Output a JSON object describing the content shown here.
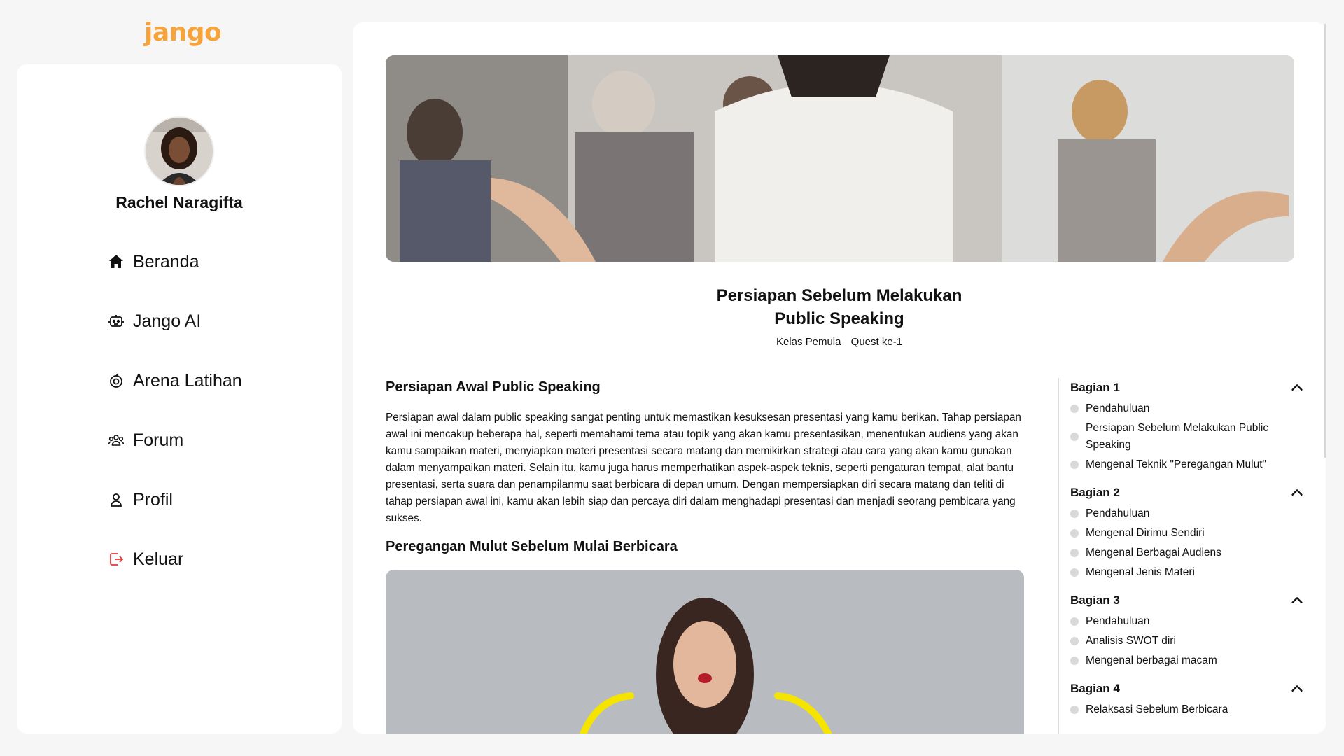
{
  "app": {
    "logo": "jango",
    "brand_color": "#f5a33a"
  },
  "sidebar": {
    "user_name": "Rachel Naragifta",
    "items": [
      {
        "label": "Beranda",
        "icon": "home-icon"
      },
      {
        "label": "Jango AI",
        "icon": "robot-icon"
      },
      {
        "label": "Arena Latihan",
        "icon": "target-icon"
      },
      {
        "label": "Forum",
        "icon": "users-icon"
      },
      {
        "label": "Profil",
        "icon": "user-icon"
      },
      {
        "label": "Keluar",
        "icon": "logout-icon",
        "color": "#e53935"
      }
    ]
  },
  "lesson": {
    "title_line1": "Persiapan Sebelum Melakukan",
    "title_line2": "Public Speaking",
    "class_label": "Kelas Pemula",
    "quest_label": "Quest ke-1",
    "section1_heading": "Persiapan Awal Public Speaking",
    "section1_body": "Persiapan awal dalam public speaking sangat penting untuk memastikan kesuksesan presentasi yang kamu berikan. Tahap persiapan awal ini mencakup beberapa hal, seperti memahami tema atau topik yang akan kamu presentasikan, menentukan audiens yang akan kamu sampaikan materi, menyiapkan materi presentasi secara matang dan memikirkan strategi atau cara yang akan kamu gunakan dalam menyampaikan materi. Selain itu, kamu juga harus memperhatikan aspek-aspek teknis, seperti pengaturan tempat, alat bantu presentasi, serta suara dan penampilanmu saat berbicara di depan umum. Dengan mempersiapkan diri secara matang dan teliti di tahap persiapan awal ini, kamu akan lebih siap dan percaya diri dalam menghadapi presentasi dan menjadi seorang pembicara yang sukses.",
    "section2_heading": "Peregangan Mulut Sebelum Mulai Berbicara"
  },
  "outline": {
    "sections": [
      {
        "title": "Bagian 1",
        "items": [
          "Pendahuluan",
          "Persiapan Sebelum Melakukan Public Speaking",
          "Mengenal Teknik \"Peregangan Mulut\""
        ]
      },
      {
        "title": "Bagian 2",
        "items": [
          "Pendahuluan",
          "Mengenal Dirimu Sendiri",
          "Mengenal Berbagai Audiens",
          "Mengenal Jenis Materi"
        ]
      },
      {
        "title": "Bagian 3",
        "items": [
          "Pendahuluan",
          "Analisis SWOT diri",
          "Mengenal berbagai macam"
        ]
      },
      {
        "title": "Bagian 4",
        "items": [
          "Relaksasi Sebelum Berbicara"
        ]
      }
    ]
  }
}
